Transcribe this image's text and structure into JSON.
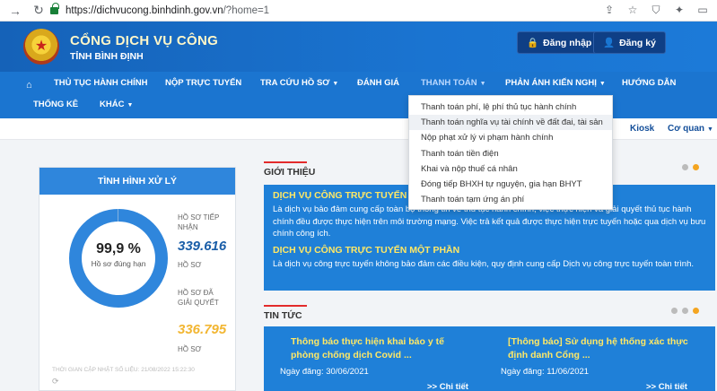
{
  "browser": {
    "url_host": "https://dichvucong.binhdinh.gov.vn",
    "url_path": "/?home=1"
  },
  "header": {
    "title": "CỔNG DỊCH VỤ CÔNG",
    "subtitle": "TỈNH BÌNH ĐỊNH",
    "login_label": "Đăng nhập",
    "register_label": "Đăng ký"
  },
  "menu": {
    "row1": [
      "THỦ TỤC HÀNH CHÍNH",
      "NỘP TRỰC TUYẾN",
      "TRA CỨU HỒ SƠ",
      "ĐÁNH GIÁ",
      "THANH TOÁN",
      "PHẢN ÁNH KIẾN NGHỊ",
      "HƯỚNG DẪN"
    ],
    "row2": [
      "THỐNG KÊ",
      "KHÁC"
    ]
  },
  "dropdown": [
    "Thanh toán phí, lệ phí thủ tục hành chính",
    "Thanh toán nghĩa vụ tài chính về đất đai, tài sản",
    "Nộp phạt xử lý vi phạm hành chính",
    "Thanh toán tiền điện",
    "Khai và nộp thuế cá nhân",
    "Đóng tiếp BHXH tự nguyện, gia hạn BHYT",
    "Thanh toán tạm ứng án phí"
  ],
  "subbar": {
    "item1": "n",
    "kiosk": "Kiosk",
    "coquan": "Cơ quan"
  },
  "side": {
    "title": "TÌNH HÌNH XỬ LÝ",
    "pct": "99,9 %",
    "pct_label": "Hồ sơ đúng hạn",
    "received_label": "HỒ SƠ TIẾP NHẬN",
    "received_value": "339.616",
    "received_unit": "HỒ SƠ",
    "resolved_label": "HỒ SƠ ĐÃ GIẢI QUYẾT",
    "resolved_value": "336.795",
    "resolved_unit": "HỒ SƠ",
    "updated": "THỜI GIAN CẬP NHẬT SỐ LIỆU: 21/08/2022 15:22:30",
    "ring_fraction": 0.999,
    "colors": {
      "ring": "#2f86dc",
      "received": "#1a5ea8",
      "resolved": "#f2b632"
    }
  },
  "intro": {
    "section": "GIỚI THIỆU",
    "h1": "DỊCH VỤ CÔNG TRỰC TUYẾN TOÀN TRÌNH",
    "p1": "Là dịch vụ bảo đảm cung cấp toàn bộ thông tin về thủ tục hành chính, việc thực hiện và giải quyết thủ tục hành chính đều được thực hiện trên môi trường mạng. Việc trả kết quả được thực hiện trực tuyến hoặc qua dịch vụ bưu chính công ích.",
    "h2": "DỊCH VỤ CÔNG TRỰC TUYẾN MỘT PHẦN",
    "p2": "Là dịch vụ công trực tuyến không bảo đảm các điều kiện, quy định cung cấp Dịch vụ công trực tuyến toàn trình."
  },
  "news": {
    "section": "TIN TỨC",
    "items": [
      {
        "title": "Thông báo thực hiện khai báo y tế phòng chống dịch Covid ...",
        "date": "Ngày đăng: 30/06/2021",
        "more": ">> Chi tiết"
      },
      {
        "title": "[Thông báo] Sử dụng hệ thống xác thực định danh Cổng ...",
        "date": "Ngày đăng: 11/06/2021",
        "more": ">> Chi tiết"
      }
    ]
  }
}
